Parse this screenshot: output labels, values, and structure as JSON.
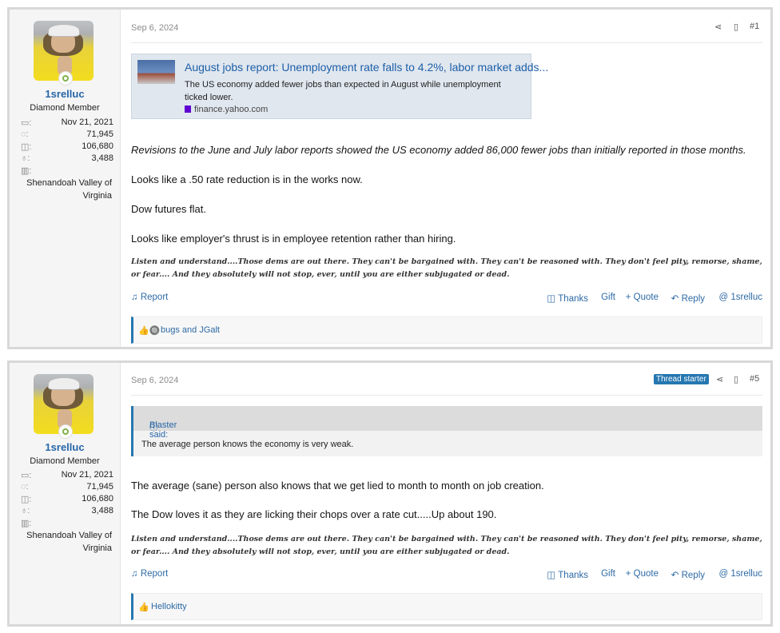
{
  "posts": [
    {
      "user": {
        "name": "1srelluc",
        "title": "Diamond Member",
        "joined": "Nov 21, 2021",
        "messages": "71,945",
        "reactions": "106,680",
        "points": "3,488",
        "location_line1": "Shenandoah Valley of",
        "location_line2": "Virginia"
      },
      "date": "Sep 6, 2024",
      "number": "#1",
      "unfurl": {
        "title": "August jobs report: Unemployment rate falls to 4.2%, labor market adds...",
        "desc": "The US economy added fewer jobs than expected in August while unemployment ticked lower.",
        "source": "finance.yahoo.com"
      },
      "body": [
        "Revisions to the June and July labor reports showed the US economy added 86,000 fewer jobs than initially reported in those months.",
        "Looks like a .50 rate reduction is in the works now.",
        "Dow futures flat.",
        "Looks like employer's thrust is in employee retention rather than hiring."
      ],
      "signature": "Listen and understand....Those dems are out there. They can't be bargained with. They can't be reasoned with. They don't feel pity, remorse, shame, or fear.... And they absolutely will not stop, ever, until you are either subjugated or dead.",
      "actions": {
        "report": "Report",
        "thanks": "Thanks",
        "gift": "Gift",
        "quote": "+ Quote",
        "reply": "Reply",
        "mention": "1srelluc"
      },
      "reactions_by": "bugs and JGalt"
    },
    {
      "user": {
        "name": "1srelluc",
        "title": "Diamond Member",
        "joined": "Nov 21, 2021",
        "messages": "71,945",
        "reactions": "106,680",
        "points": "3,488",
        "location_line1": "Shenandoah Valley of",
        "location_line2": "Virginia"
      },
      "date": "Sep 6, 2024",
      "badge": "Thread starter",
      "number": "#5",
      "quote": {
        "author": "Blaster said:",
        "text": "The average person knows the economy is very weak."
      },
      "body": [
        "The average (sane) person also knows that we get lied to month to month on job creation.",
        "The Dow loves it as they are licking their chops over a rate cut.....Up about 190."
      ],
      "signature": "Listen and understand....Those dems are out there. They can't be bargained with. They can't be reasoned with. They don't feel pity, remorse, shame, or fear.... And they absolutely will not stop, ever, until you are either subjugated or dead.",
      "actions": {
        "report": "Report",
        "thanks": "Thanks",
        "gift": "Gift",
        "quote": "+ Quote",
        "reply": "Reply",
        "mention": "1srelluc"
      },
      "reactions_by": "Hellokitty"
    }
  ],
  "icons": {
    "calendar": "calendar-icon",
    "messages": "messages-icon",
    "reactions": "thumbs-up-icon",
    "trophy": "trophy-icon",
    "location": "map-icon",
    "share": "share-icon",
    "bookmark": "bookmark-icon",
    "bell": "bell-icon",
    "reply": "reply-icon",
    "mention": "at-icon",
    "arrow_up": "arrow-up-circle-icon"
  },
  "colors": {
    "link": "#2766a8",
    "accent": "#2577b1"
  }
}
